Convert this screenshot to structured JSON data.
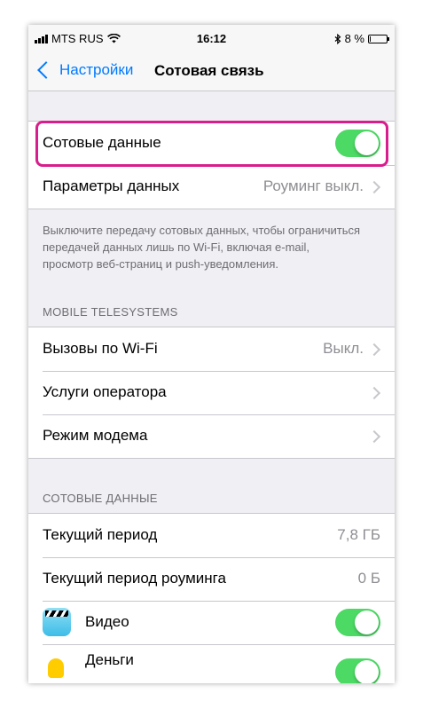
{
  "status_bar": {
    "carrier": "MTS RUS",
    "time": "16:12",
    "battery": "8 %",
    "battery_level": 0.08
  },
  "nav": {
    "back_label": "Настройки",
    "title": "Сотовая связь"
  },
  "cellular_data": {
    "label": "Сотовые данные",
    "enabled": true,
    "options_label": "Параметры данных",
    "options_value": "Роуминг выкл.",
    "footer": "Выключите передачу сотовых данных, чтобы ограничиться передачей данных лишь по Wi-Fi, включая e-mail, просмотр веб-страниц и push-уведомления."
  },
  "carrier_section": {
    "header": "MOBILE TELESYSTEMS",
    "rows": [
      {
        "label": "Вызовы по Wi-Fi",
        "value": "Выкл."
      },
      {
        "label": "Услуги оператора",
        "value": ""
      },
      {
        "label": "Режим модема",
        "value": ""
      }
    ]
  },
  "usage_section": {
    "header": "СОТОВЫЕ ДАННЫЕ",
    "current_period_label": "Текущий период",
    "current_period_value": "7,8 ГБ",
    "roaming_period_label": "Текущий период роуминга",
    "roaming_period_value": "0 Б",
    "apps": [
      {
        "name": "Видео",
        "icon": "video-clapper-icon",
        "enabled": true
      },
      {
        "name": "Деньги",
        "icon": "money-icon",
        "enabled": true
      }
    ]
  },
  "colors": {
    "accent": "#007aff",
    "switch_on": "#4cd964",
    "highlight": "#d81e8c",
    "background": "#efeff4"
  }
}
